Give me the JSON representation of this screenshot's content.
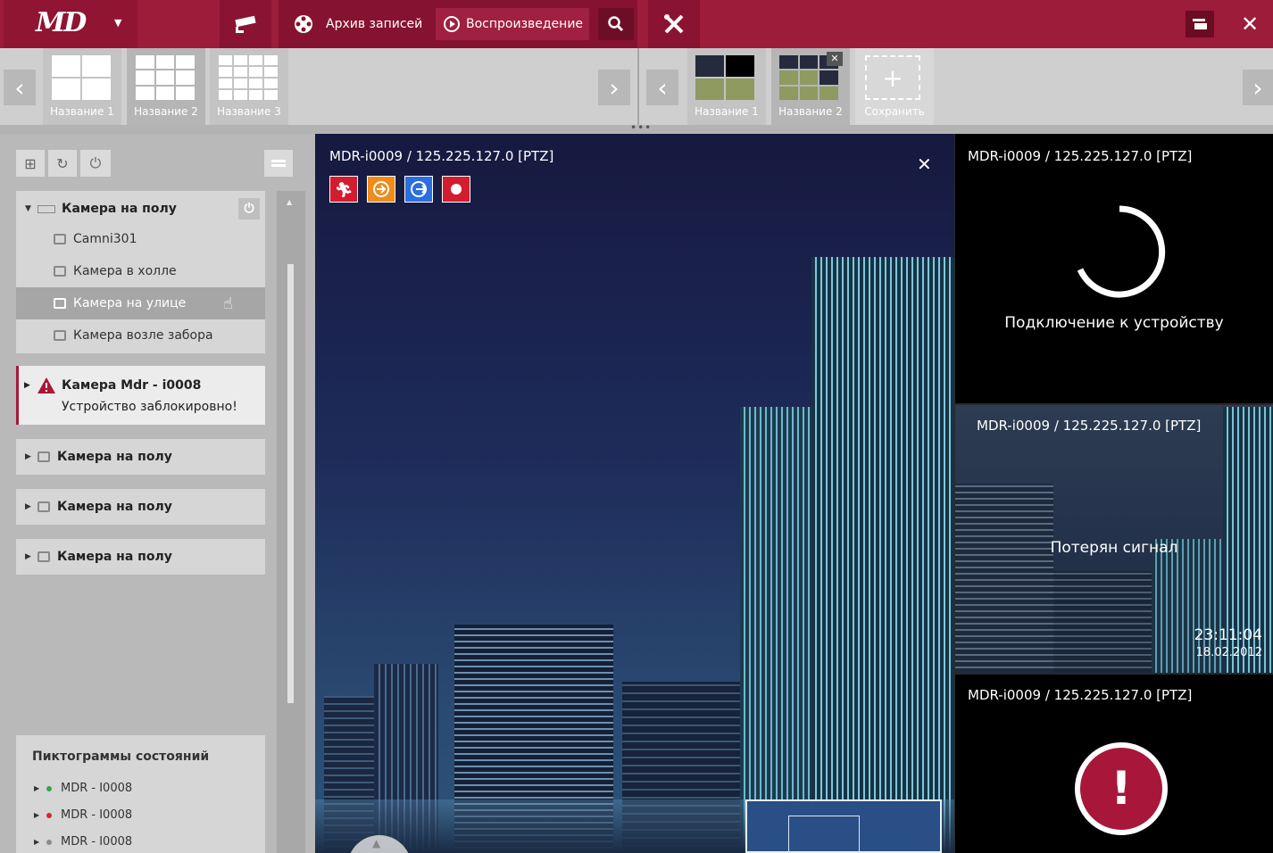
{
  "topbar": {
    "logo": "MD",
    "archive_label": "Архив записей",
    "playback_label": "Воспроизведение"
  },
  "layouts_left": [
    {
      "label": "Название 1"
    },
    {
      "label": "Название 2"
    },
    {
      "label": "Название 3"
    }
  ],
  "layouts_right": [
    {
      "label": "Название 1"
    },
    {
      "label": "Название 2"
    },
    {
      "label": "Сохранить"
    }
  ],
  "sidebar": {
    "group1": {
      "title": "Камера на полу",
      "cameras": [
        "Camni301",
        "Камера в холле",
        "Камера на улице",
        "Камера возле забора"
      ]
    },
    "alert": {
      "title": "Камера Mdr - i0008",
      "message": "Устройство заблокировно!"
    },
    "groups": [
      "Камера на полу",
      "Камера на полу",
      "Камера на полу"
    ],
    "legend": {
      "title": "Пиктограммы состояний",
      "items": [
        {
          "label": "MDR - I0008",
          "color": "#2ea84a"
        },
        {
          "label": "MDR - I0008",
          "color": "#d12a2a"
        },
        {
          "label": "MDR - I0008",
          "color": "#8a8a8a"
        }
      ]
    }
  },
  "main": {
    "title": "MDR-i0009 / 125.225.127.0 [PTZ]"
  },
  "right": {
    "cell1": {
      "title": "MDR-i0009 / 125.225.127.0 [PTZ]",
      "status": "Подключение к устройству"
    },
    "cell2": {
      "title": "MDR-i0009 / 125.225.127.0 [PTZ]",
      "status": "Потерян сигнал",
      "time": "23:11:04",
      "date": "18.02.2012"
    },
    "cell3": {
      "title": "MDR-i0009 / 125.225.127.0 [PTZ]",
      "alert_symbol": "!"
    }
  },
  "colors": {
    "brand": "#9c1c3a",
    "alert": "#a8173a"
  }
}
